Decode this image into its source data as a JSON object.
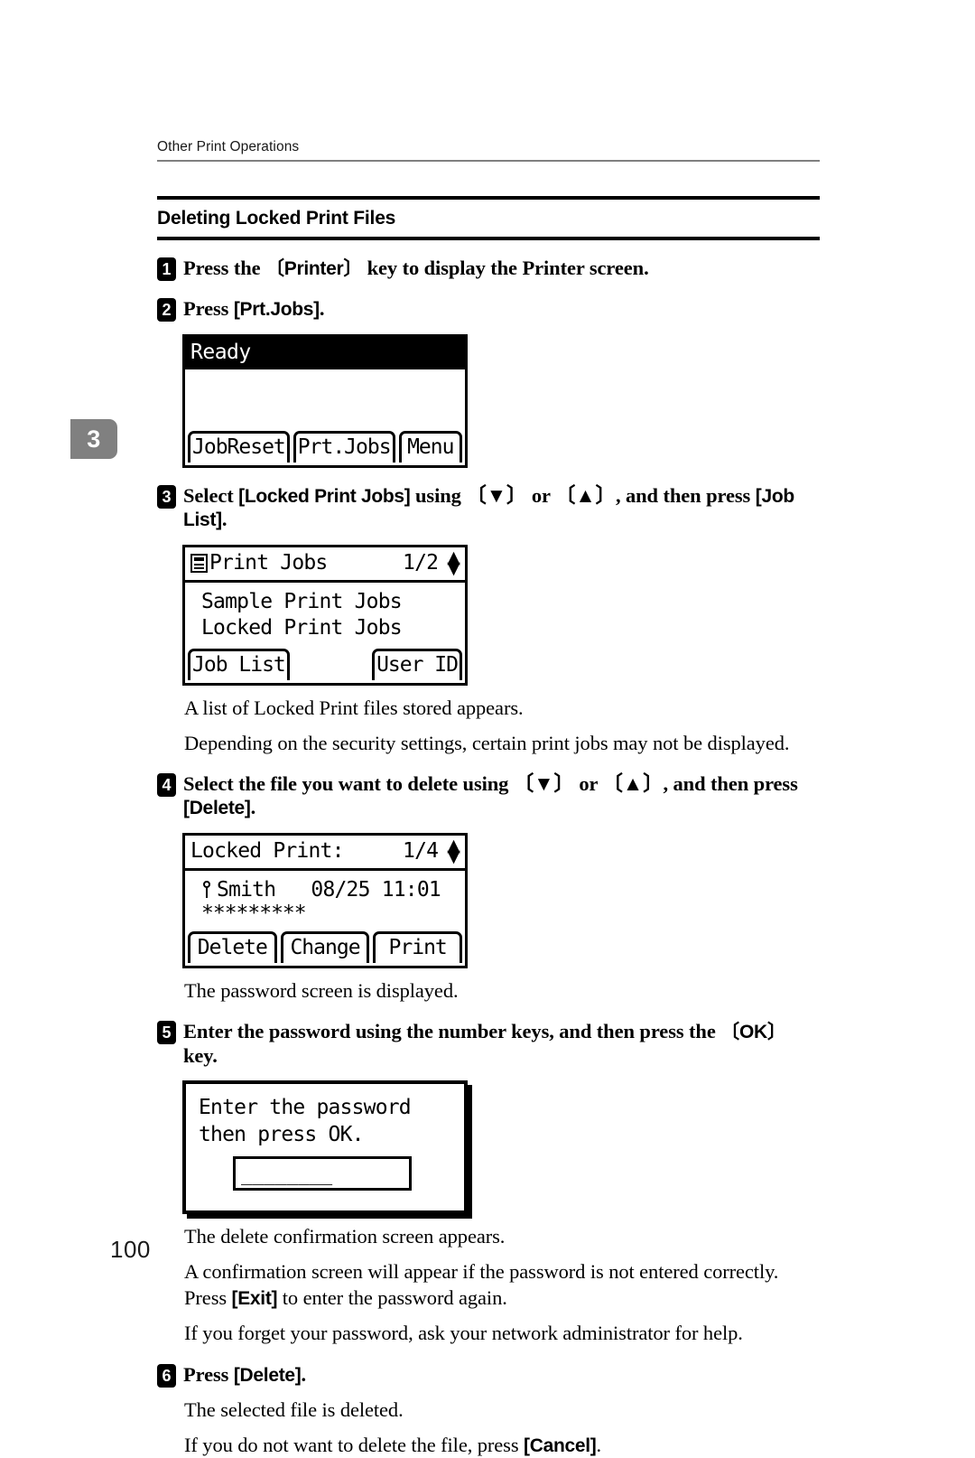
{
  "page": {
    "running_head": "Other Print Operations",
    "section_title": "Deleting Locked Print Files",
    "chapter_tab": "3",
    "page_number": "100"
  },
  "steps": [
    {
      "number": "1",
      "parts": [
        {
          "type": "text",
          "value": "Press the "
        },
        {
          "type": "keycap",
          "value": "〔Printer〕"
        },
        {
          "type": "text",
          "value": " key to display the Printer screen."
        }
      ],
      "plain": "Press the 〔Printer〕 key to display the Printer screen."
    },
    {
      "number": "2",
      "parts": [
        {
          "type": "text",
          "value": "Press "
        },
        {
          "type": "ui",
          "value": "[Prt.Jobs]"
        },
        {
          "type": "text",
          "value": "."
        }
      ],
      "plain": "Press [Prt.Jobs]."
    },
    {
      "number": "3",
      "parts": [
        {
          "type": "text",
          "value": "Select "
        },
        {
          "type": "ui",
          "value": "[Locked Print Jobs]"
        },
        {
          "type": "text",
          "value": " using 〔▼〕 or 〔▲〕, and then press "
        },
        {
          "type": "ui",
          "value": "[Job List]"
        },
        {
          "type": "text",
          "value": "."
        }
      ],
      "plain": "Select [Locked Print Jobs] using 〔▼〕 or 〔▲〕, and then press [Job List]."
    },
    {
      "number": "4",
      "parts": [
        {
          "type": "text",
          "value": "Select the file you want to delete using 〔▼〕 or 〔▲〕, and then press "
        },
        {
          "type": "ui",
          "value": "[Delete]"
        },
        {
          "type": "text",
          "value": "."
        }
      ],
      "plain": "Select the file you want to delete using 〔▼〕 or 〔▲〕, and then press [Delete]."
    },
    {
      "number": "5",
      "parts": [
        {
          "type": "text",
          "value": "Enter the password using the number keys, and then press the "
        },
        {
          "type": "keycap",
          "value": "〔OK〕"
        },
        {
          "type": "text",
          "value": " key."
        }
      ],
      "plain": "Enter the password using the number keys, and then press the 〔OK〕 key."
    },
    {
      "number": "6",
      "parts": [
        {
          "type": "text",
          "value": "Press "
        },
        {
          "type": "ui",
          "value": "[Delete]"
        },
        {
          "type": "text",
          "value": "."
        }
      ],
      "plain": "Press [Delete]."
    }
  ],
  "paragraphs": {
    "after_step3_a": "A list of Locked Print files stored appears.",
    "after_step3_b": "Depending on the security settings, certain print jobs may not be displayed.",
    "after_step4": "The password screen is displayed.",
    "after_step5_a": "The delete confirmation screen appears.",
    "after_step5_b_pre": "A confirmation screen will appear if the password is not entered correctly. Press ",
    "after_step5_b_ui": "[Exit]",
    "after_step5_b_post": " to enter the password again.",
    "after_step5_c": "If you forget your password, ask your network administrator for help.",
    "after_step6_a": "The selected file is deleted.",
    "after_step6_b_pre": "If you do not want to delete the file, press ",
    "after_step6_b_ui": "[Cancel]",
    "after_step6_b_post": "."
  },
  "lcd_ready": {
    "title": "Ready",
    "softkeys": [
      "JobReset",
      "Prt.Jobs",
      "Menu"
    ]
  },
  "lcd_print_jobs": {
    "icon": "document-list-icon",
    "title": "Print Jobs",
    "page_indicator": "1/2",
    "scroll_arrows": "▲▼",
    "items": [
      {
        "label": "Sample Print Jobs",
        "selected": false
      },
      {
        "label": "Locked Print Jobs",
        "selected": true
      }
    ],
    "softkeys": [
      "Job List",
      "User ID"
    ]
  },
  "lcd_locked_print": {
    "title": "Locked Print:",
    "page_indicator": "1/4",
    "scroll_arrows": "▲▼",
    "icon": "key-icon",
    "user": "Smith",
    "timestamp": "08/25 11:01",
    "filename_masked": "*********",
    "softkeys": [
      "Delete",
      "Change",
      "Print"
    ]
  },
  "lcd_password": {
    "line1": "Enter the password",
    "line2": "then press OK.",
    "input_value": "________",
    "input_placeholder": ""
  }
}
